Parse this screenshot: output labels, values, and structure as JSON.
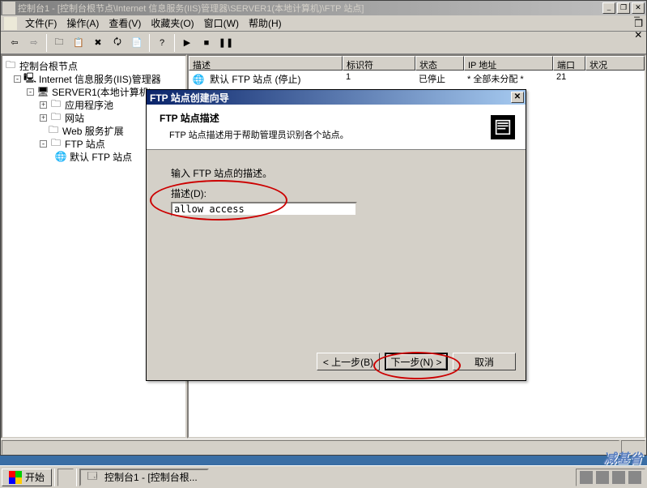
{
  "window": {
    "title": "控制台1 - [控制台根节点\\Internet 信息服务(IIS)管理器\\SERVER1(本地计算机)\\FTP 站点]"
  },
  "menu": {
    "file": "文件(F)",
    "action": "操作(A)",
    "view": "查看(V)",
    "favorites": "收藏夹(O)",
    "window": "窗口(W)",
    "help": "帮助(H)"
  },
  "tree": {
    "root": "控制台根节点",
    "iis": "Internet 信息服务(IIS)管理器",
    "server": "SERVER1(本地计算机)",
    "apppool": "应用程序池",
    "sites": "网站",
    "webext": "Web 服务扩展",
    "ftp": "FTP 站点",
    "defaultftp": "默认 FTP 站点"
  },
  "list": {
    "cols": {
      "desc": "描述",
      "id": "标识符",
      "state": "状态",
      "ip": "IP 地址",
      "port": "端口",
      "status": "状况"
    },
    "row": {
      "desc": "默认 FTP 站点 (停止)",
      "id": "1",
      "state": "已停止",
      "ip": "* 全部未分配 *",
      "port": "21",
      "status": ""
    }
  },
  "wizard": {
    "title": "FTP 站点创建向导",
    "header_title": "FTP 站点描述",
    "header_sub": "FTP 站点描述用于帮助管理员识别各个站点。",
    "prompt": "输入 FTP 站点的描述。",
    "label": "描述(D):",
    "input_value": "allow access",
    "back": "< 上一步(B)",
    "next": "下一步(N) >",
    "cancel": "取消"
  },
  "taskbar": {
    "start": "开始",
    "task": "控制台1 - [控制台根...",
    "watermark": "减基省"
  }
}
